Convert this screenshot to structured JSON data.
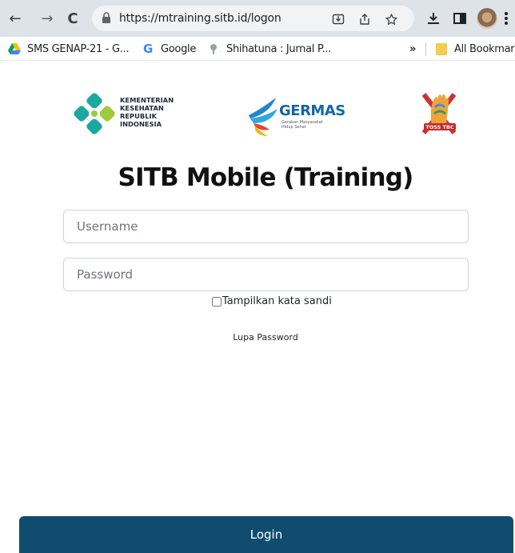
{
  "browser": {
    "url": "https://mtraining.sitb.id/logon",
    "nav": {
      "back": "←",
      "forward": "→",
      "reload": "C"
    },
    "bookmarks": [
      {
        "label": "SMS GENAP-21 - G...",
        "icon": "google-drive-icon"
      },
      {
        "label": "Google",
        "icon": "google-g-icon"
      },
      {
        "label": "Shihatuna : Jurnal P...",
        "icon": "site-favicon-icon"
      }
    ],
    "overflow_chevron": "»",
    "all_bookmarks": "All Bookmarks"
  },
  "logos": {
    "kemenkes": [
      "KEMENTERIAN",
      "KESEHATAN",
      "REPUBLIK",
      "INDONESIA"
    ],
    "germas": {
      "name": "GERMAS",
      "tagline_1": "Gerakan Masyarakat",
      "tagline_2": "Hidup Sehat"
    },
    "tbc": "TOSS TBC"
  },
  "page": {
    "title": "SITB Mobile (Training)",
    "username_placeholder": "Username",
    "password_placeholder": "Password",
    "show_password_label": "Tampilkan kata sandi",
    "forgot_password": "Lupa Password",
    "login_label": "Login"
  },
  "colors": {
    "accent": "#0f4c6e",
    "kemenkes_teal": "#1aa9a0",
    "kemenkes_green": "#9ccb3b"
  }
}
